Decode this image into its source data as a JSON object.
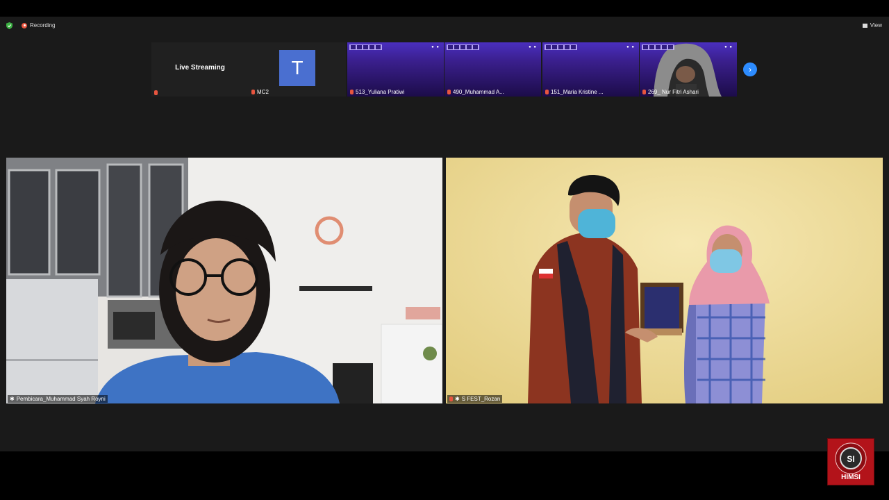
{
  "topbar": {
    "recording_label": "Recording",
    "view_label": "View"
  },
  "strip": {
    "live_streaming": {
      "label": "Live Streaming"
    },
    "mc2": {
      "avatar_letter": "T",
      "name": "MC2"
    },
    "participants": [
      {
        "name": "513_Yuliana Pratiwi"
      },
      {
        "name": "490_Muhammad A..."
      },
      {
        "name": "151_Maria Kristine ..."
      },
      {
        "name": "269_ Nur Fitri Ashari"
      }
    ],
    "next_icon": "chevron-right-icon"
  },
  "main": {
    "left_video": {
      "name": "Pembicara_Muhammad Syah Royni"
    },
    "right_video": {
      "name": "S FEST_Rozan"
    }
  },
  "overlay_logo": {
    "text": "HIMSI",
    "inner": "SI"
  },
  "colors": {
    "accent": "#2d8cff",
    "recording": "#e8553f",
    "sfest_purple": "#3a1f8c",
    "logo_red": "#b3131a"
  }
}
